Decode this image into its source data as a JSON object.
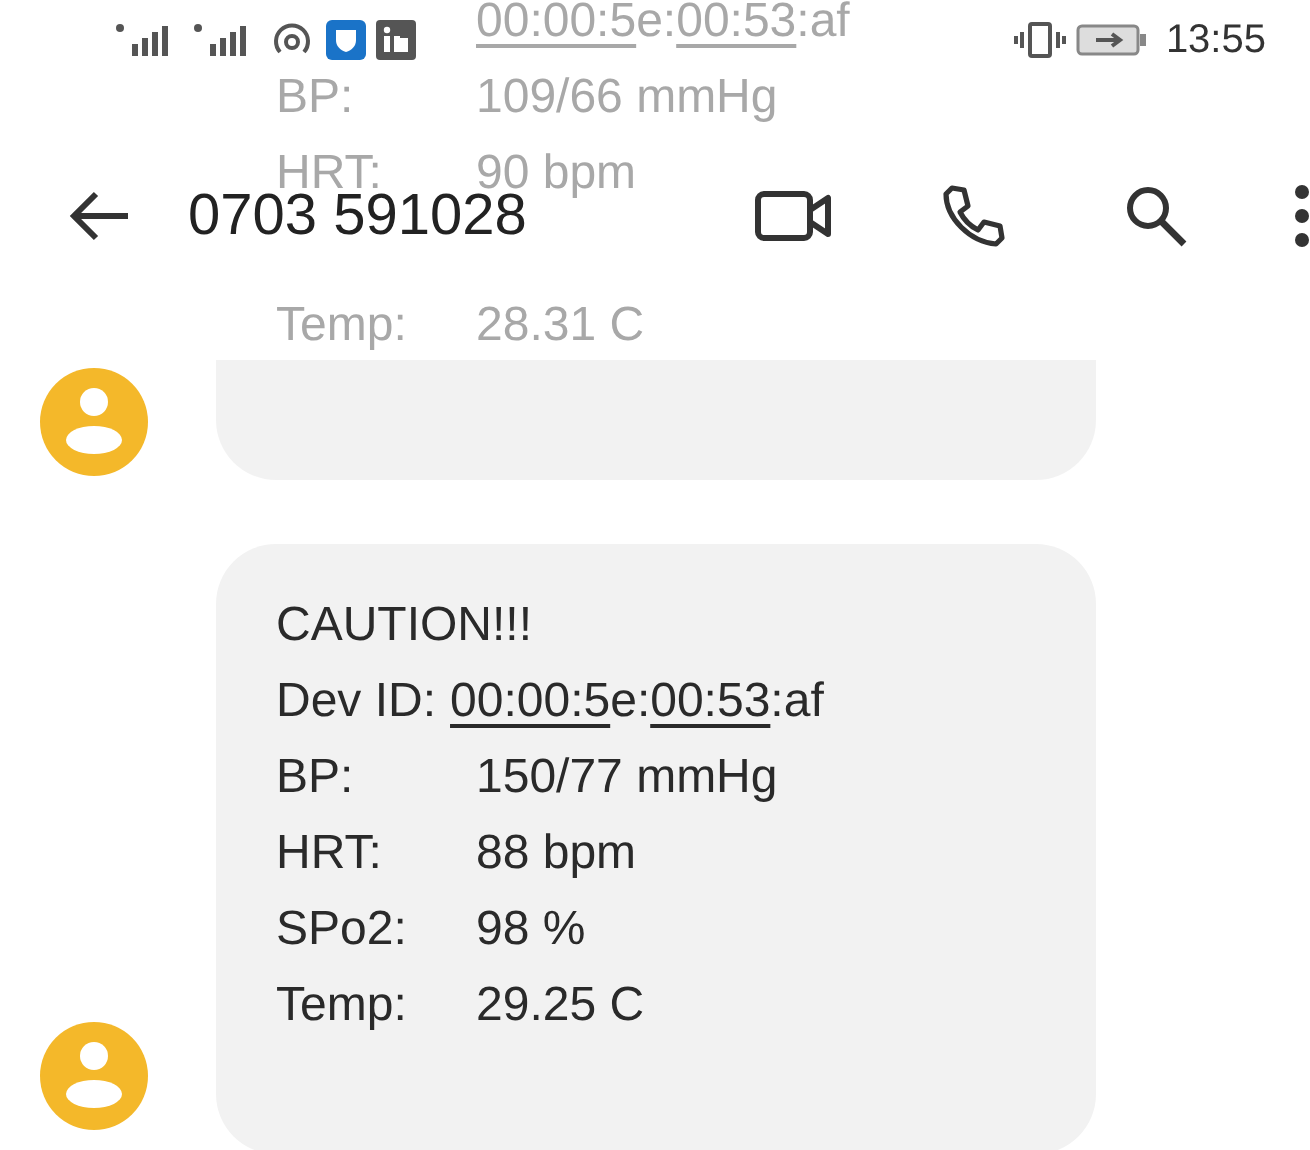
{
  "status_bar": {
    "time": "13:55"
  },
  "header": {
    "title": "0703 591028"
  },
  "messages": [
    {
      "partial": true,
      "lines": [
        {
          "parts": [
            {
              "text": "00:00:5",
              "link": true
            },
            {
              "text": "e:",
              "link": false
            },
            {
              "text": "00:53",
              "link": true
            },
            {
              "text": ":af",
              "link": false
            }
          ]
        },
        {
          "label": "BP:",
          "value": "109/66 mmHg"
        },
        {
          "label": "HRT:",
          "value": "90 bpm"
        },
        {
          "label": "Temp:",
          "value": "28.31 C"
        }
      ]
    },
    {
      "partial": false,
      "lines": [
        {
          "label": "CAUTION!!!"
        },
        {
          "label": "Dev ID:",
          "parts": [
            {
              "text": "00:00:5",
              "link": true
            },
            {
              "text": "e:",
              "link": false
            },
            {
              "text": "00:53",
              "link": true
            },
            {
              "text": ":af",
              "link": false
            }
          ]
        },
        {
          "label": "BP:",
          "value": "150/77 mmHg"
        },
        {
          "label": "HRT:",
          "value": "88 bpm"
        },
        {
          "label": "SPo2:",
          "value": "98 %"
        },
        {
          "label": "Temp:",
          "value": "29.25 C"
        }
      ]
    }
  ]
}
